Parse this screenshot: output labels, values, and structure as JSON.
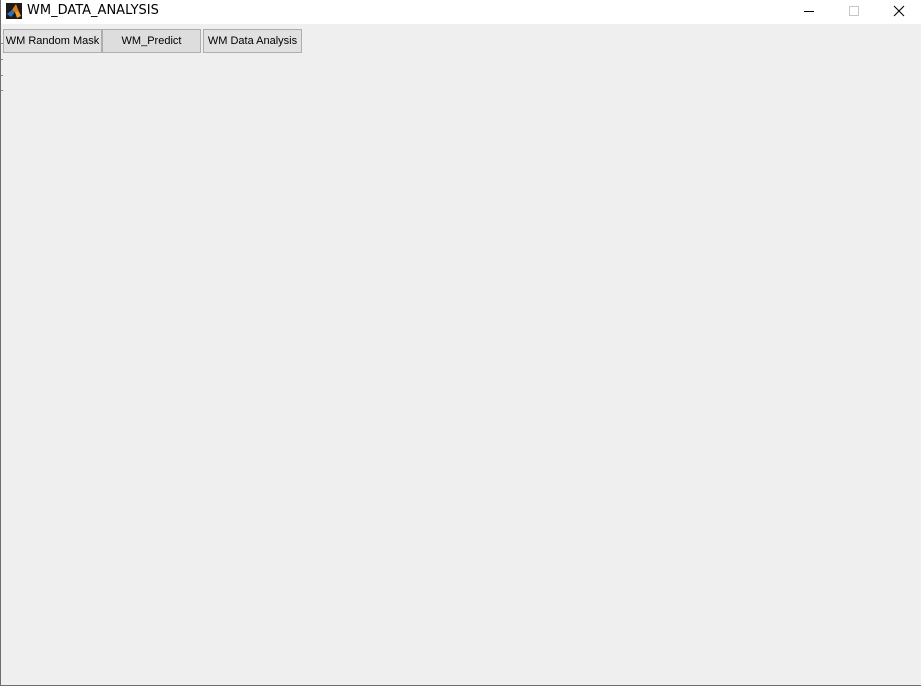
{
  "window": {
    "title": "WM_DATA_ANALYSIS",
    "app_icon": "matlab-icon",
    "controls": {
      "minimize_icon": "minimize-icon",
      "maximize_icon": "maximize-icon",
      "close_icon": "close-icon"
    }
  },
  "toolbar": {
    "buttons": [
      {
        "label": "WM Random Mask"
      },
      {
        "label": "WM_Predict"
      },
      {
        "label": "WM Data Analysis"
      }
    ]
  },
  "colors": {
    "titlebar_bg": "#ffffff",
    "client_bg": "#efefef",
    "button_bg": "#e1e1e1",
    "button_border": "#adadad"
  }
}
